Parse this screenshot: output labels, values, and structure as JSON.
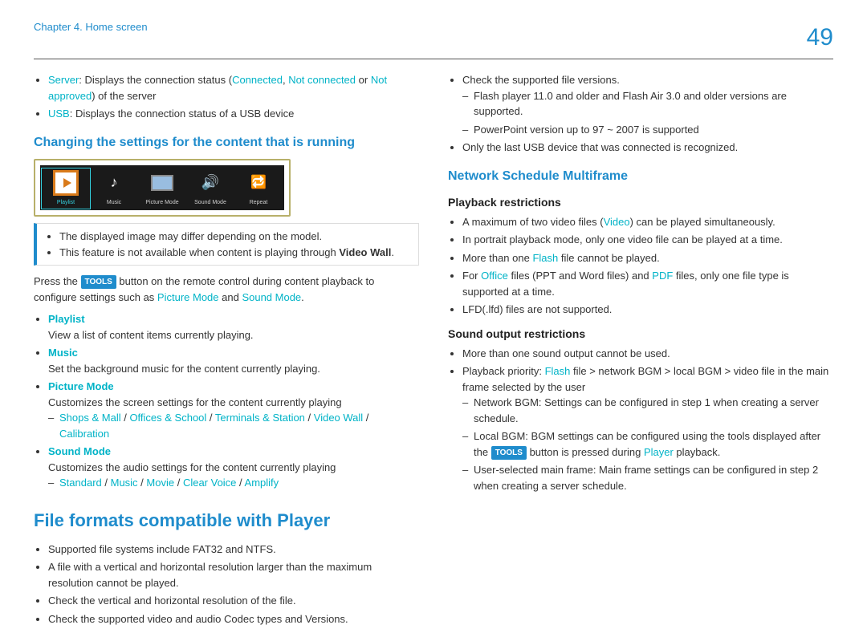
{
  "header": {
    "breadcrumb": "Chapter 4. Home screen",
    "page": "49"
  },
  "left": {
    "server_bullets": {
      "server_label": "Server",
      "server_rest1": ": Displays the connection status (",
      "server_connected": "Connected",
      "server_comma": ", ",
      "server_notconn": "Not connected",
      "server_or": " or ",
      "server_notapp": "Not approved",
      "server_rest2": ") of the server",
      "usb_label": "USB",
      "usb_rest": ": Displays the connection status of a USB device"
    },
    "h3_changing": "Changing the settings for the content that is running",
    "icons": {
      "playlist": "Playlist",
      "music": "Music",
      "picture": "Picture Mode",
      "sound": "Sound Mode",
      "repeat": "Repeat"
    },
    "note1": "The displayed image may differ depending on the model.",
    "note2a": "This feature is not available when content is playing through ",
    "note2b": "Video Wall",
    "note2c": ".",
    "press1": "Press the ",
    "tools_pill": "TOOLS",
    "press2": " button on the remote control during content playback to configure settings such as ",
    "press_pm": "Picture Mode",
    "press_and": " and ",
    "press_sm": "Sound Mode",
    "press_dot": ".",
    "playlist_label": "Playlist",
    "playlist_desc": "View a list of content items currently playing.",
    "music_label": "Music",
    "music_desc": "Set the background music for the content currently playing.",
    "pm_label": "Picture Mode",
    "pm_desc": "Customizes the screen settings for the content currently playing",
    "pm_opts": {
      "a": "Shops & Mall",
      "b": "Offices & School",
      "c": "Terminals & Station",
      "d": "Video Wall",
      "e": "Calibration"
    },
    "sm_label": "Sound Mode",
    "sm_desc": "Customizes the audio settings for the content currently playing",
    "sm_opts": {
      "a": "Standard",
      "b": "Music",
      "c": "Movie",
      "d": "Clear Voice",
      "e": "Amplify"
    },
    "h2_file": "File formats compatible with Player",
    "ff1": "Supported file systems include FAT32 and NTFS.",
    "ff2": "A file with a vertical and horizontal resolution larger than the maximum resolution cannot be played.",
    "ff3": "Check the vertical and horizontal resolution of the file.",
    "ff4": "Check the supported video and audio Codec types and Versions."
  },
  "right": {
    "r1": "Check the supported file versions.",
    "r1a": "Flash player 11.0 and older and Flash Air 3.0 and older versions are supported.",
    "r1b": "PowerPoint version up to 97 ~ 2007 is supported",
    "r2": "Only the last USB device that was connected is recognized.",
    "h3_net": "Network Schedule Multiframe",
    "h4_play": "Playback restrictions",
    "p1a": "A maximum of two video files (",
    "p1_video": "Video",
    "p1b": ") can be played simultaneously.",
    "p2": "In portrait playback mode, only one video file can be played at a time.",
    "p3a": "More than one ",
    "p3_flash": "Flash",
    "p3b": " file cannot be played.",
    "p4a": "For ",
    "p4_office": "Office",
    "p4b": " files (PPT and Word files) and ",
    "p4_pdf": "PDF",
    "p4c": " files, only one file type is supported at a time.",
    "p5": "LFD(.lfd) files are not supported.",
    "h4_sound": "Sound output restrictions",
    "s1": "More than one sound output cannot be used.",
    "s2a": "Playback priority: ",
    "s2_flash": "Flash",
    "s2b": " file > network BGM > local BGM > video file in the main frame selected by the user",
    "s3": "Network BGM: Settings can be configured in step 1 when creating a server schedule.",
    "s4a": "Local BGM: BGM settings can be configured using the tools displayed after the ",
    "s4_tools": "TOOLS",
    "s4b": " button is pressed during ",
    "s4_player": "Player",
    "s4c": " playback.",
    "s5": "User-selected main frame: Main frame settings can be configured in step 2 when creating a server schedule."
  }
}
